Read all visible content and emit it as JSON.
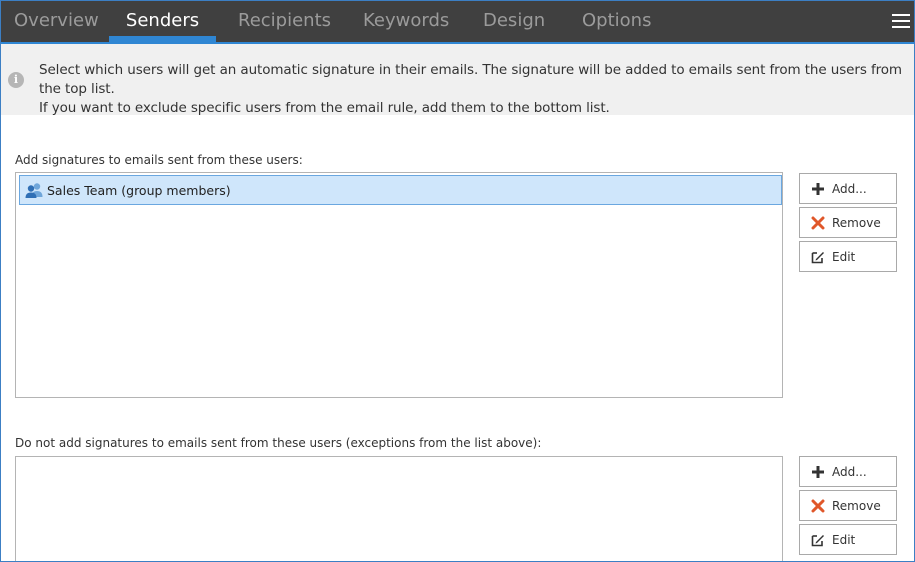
{
  "tabs": [
    {
      "label": "Overview",
      "active": false
    },
    {
      "label": "Senders",
      "active": true
    },
    {
      "label": "Recipients",
      "active": false
    },
    {
      "label": "Keywords",
      "active": false
    },
    {
      "label": "Design",
      "active": false
    },
    {
      "label": "Options",
      "active": false
    }
  ],
  "info": {
    "line1": "Select which users will get an automatic signature in their emails. The signature will be added to emails sent from the users from the top list.",
    "line2": "If you want to exclude specific users from the email rule, add them to the bottom list."
  },
  "include": {
    "label": "Add signatures to emails sent from these users:",
    "items": [
      {
        "label": "Sales Team (group members)",
        "icon": "user-group-icon",
        "selected": true
      }
    ],
    "add_label": "Add...",
    "remove_label": "Remove",
    "edit_label": "Edit"
  },
  "exclude": {
    "label": "Do not add signatures to emails sent from these users (exceptions from the list above):",
    "items": [],
    "add_label": "Add...",
    "remove_label": "Remove",
    "edit_label": "Edit"
  },
  "colors": {
    "accent": "#2f86d3",
    "tabbar_bg": "#404040",
    "info_bg": "#f0f0f0",
    "selection_bg": "#cfe6fb",
    "remove_icon": "#e0572a"
  }
}
